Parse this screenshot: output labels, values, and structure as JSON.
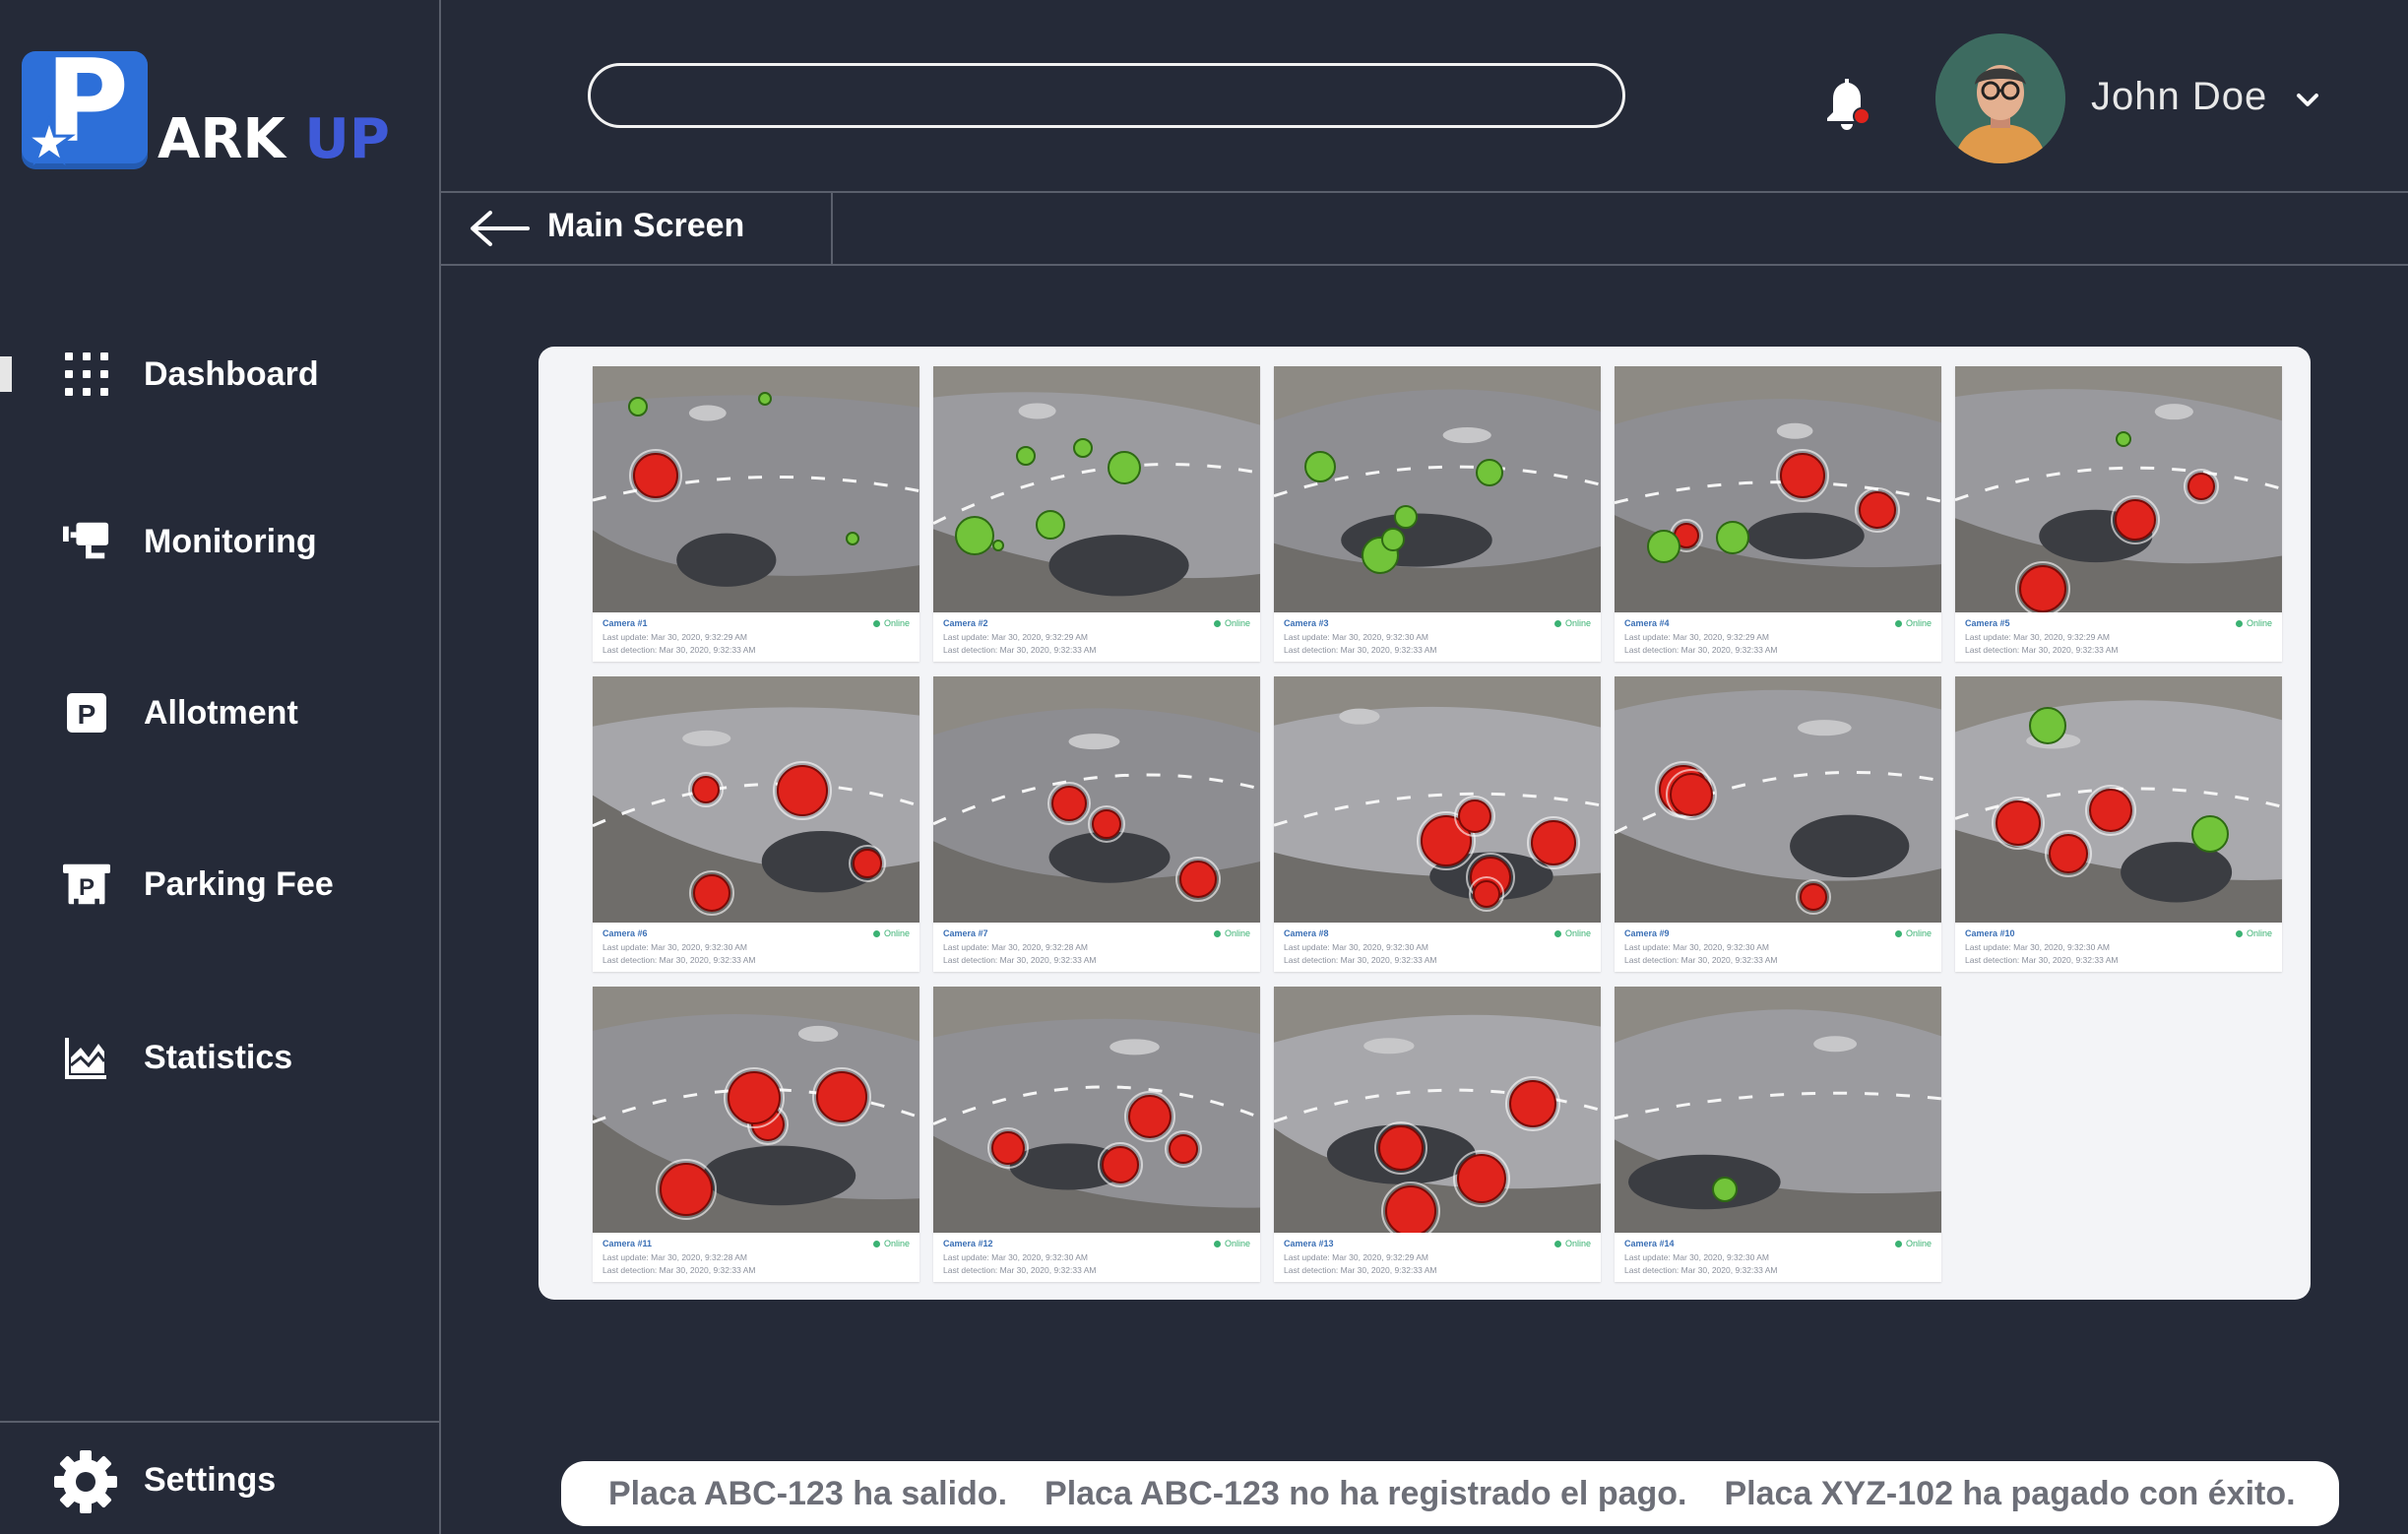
{
  "app": {
    "logo_letter": "P",
    "logo_text_1": "ARK",
    "logo_text_2": " UP"
  },
  "header": {
    "search": {
      "value": "",
      "placeholder": ""
    },
    "user_name": "John Doe"
  },
  "breadcrumb": {
    "title": "Main Screen"
  },
  "sidebar": {
    "items": [
      {
        "label": "Dashboard",
        "icon": "dashboard-grid-icon",
        "active": true
      },
      {
        "label": "Monitoring",
        "icon": "cctv-camera-icon",
        "active": false
      },
      {
        "label": "Allotment",
        "icon": "parking-p-icon",
        "active": false
      },
      {
        "label": "Parking Fee",
        "icon": "parking-fee-icon",
        "active": false
      },
      {
        "label": "Statistics",
        "icon": "statistics-chart-icon",
        "active": false
      }
    ],
    "settings_label": "Settings"
  },
  "cameras": [
    {
      "name": "Camera #1",
      "status": "Online",
      "last_update": "Last update: Mar 30, 2020, 9:32:29 AM",
      "last_detection": "Last detection: Mar 30, 2020, 9:32:33 AM",
      "occupied": 1,
      "free": 3
    },
    {
      "name": "Camera #2",
      "status": "Online",
      "last_update": "Last update: Mar 30, 2020, 9:32:29 AM",
      "last_detection": "Last detection: Mar 30, 2020, 9:32:33 AM",
      "occupied": 0,
      "free": 6
    },
    {
      "name": "Camera #3",
      "status": "Online",
      "last_update": "Last update: Mar 30, 2020, 9:32:30 AM",
      "last_detection": "Last detection: Mar 30, 2020, 9:32:33 AM",
      "occupied": 0,
      "free": 5
    },
    {
      "name": "Camera #4",
      "status": "Online",
      "last_update": "Last update: Mar 30, 2020, 9:32:29 AM",
      "last_detection": "Last detection: Mar 30, 2020, 9:32:33 AM",
      "occupied": 3,
      "free": 2
    },
    {
      "name": "Camera #5",
      "status": "Online",
      "last_update": "Last update: Mar 30, 2020, 9:32:29 AM",
      "last_detection": "Last detection: Mar 30, 2020, 9:32:33 AM",
      "occupied": 3,
      "free": 1
    },
    {
      "name": "Camera #6",
      "status": "Online",
      "last_update": "Last update: Mar 30, 2020, 9:32:30 AM",
      "last_detection": "Last detection: Mar 30, 2020, 9:32:33 AM",
      "occupied": 4,
      "free": 0
    },
    {
      "name": "Camera #7",
      "status": "Online",
      "last_update": "Last update: Mar 30, 2020, 9:32:28 AM",
      "last_detection": "Last detection: Mar 30, 2020, 9:32:33 AM",
      "occupied": 3,
      "free": 0
    },
    {
      "name": "Camera #8",
      "status": "Online",
      "last_update": "Last update: Mar 30, 2020, 9:32:30 AM",
      "last_detection": "Last detection: Mar 30, 2020, 9:32:33 AM",
      "occupied": 5,
      "free": 0
    },
    {
      "name": "Camera #9",
      "status": "Online",
      "last_update": "Last update: Mar 30, 2020, 9:32:30 AM",
      "last_detection": "Last detection: Mar 30, 2020, 9:32:33 AM",
      "occupied": 4,
      "free": 0
    },
    {
      "name": "Camera #10",
      "status": "Online",
      "last_update": "Last update: Mar 30, 2020, 9:32:30 AM",
      "last_detection": "Last detection: Mar 30, 2020, 9:32:33 AM",
      "occupied": 3,
      "free": 2
    },
    {
      "name": "Camera #11",
      "status": "Online",
      "last_update": "Last update: Mar 30, 2020, 9:32:28 AM",
      "last_detection": "Last detection: Mar 30, 2020, 9:32:33 AM",
      "occupied": 4,
      "free": 0
    },
    {
      "name": "Camera #12",
      "status": "Online",
      "last_update": "Last update: Mar 30, 2020, 9:32:30 AM",
      "last_detection": "Last detection: Mar 30, 2020, 9:32:33 AM",
      "occupied": 4,
      "free": 0
    },
    {
      "name": "Camera #13",
      "status": "Online",
      "last_update": "Last update: Mar 30, 2020, 9:32:29 AM",
      "last_detection": "Last detection: Mar 30, 2020, 9:32:33 AM",
      "occupied": 4,
      "free": 0
    },
    {
      "name": "Camera #14",
      "status": "Online",
      "last_update": "Last update: Mar 30, 2020, 9:32:30 AM",
      "last_detection": "Last detection: Mar 30, 2020, 9:32:33 AM",
      "occupied": 0,
      "free": 1
    }
  ],
  "notifications": [
    "Placa ABC-123 ha salido.",
    "Placa ABC-123 no ha registrado el pago.",
    "Placa XYZ-102 ha pagado con éxito."
  ],
  "colors": {
    "background": "#252a38",
    "brand_blue": "#2d6fd8",
    "logo_up": "#3f5ad8",
    "occupied": "#e0231c",
    "free": "#72c43a",
    "online": "#3bb273"
  }
}
